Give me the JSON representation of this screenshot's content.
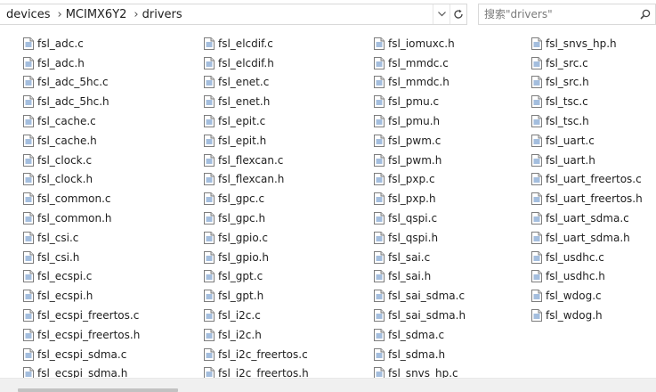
{
  "address_bar": {
    "crumbs": [
      "devices",
      "MCIMX6Y2",
      "drivers"
    ]
  },
  "search": {
    "placeholder": "搜索\"drivers\""
  },
  "files": {
    "columns": [
      [
        "fsl_adc.c",
        "fsl_adc.h",
        "fsl_adc_5hc.c",
        "fsl_adc_5hc.h",
        "fsl_cache.c",
        "fsl_cache.h",
        "fsl_clock.c",
        "fsl_clock.h",
        "fsl_common.c",
        "fsl_common.h",
        "fsl_csi.c",
        "fsl_csi.h",
        "fsl_ecspi.c",
        "fsl_ecspi.h",
        "fsl_ecspi_freertos.c",
        "fsl_ecspi_freertos.h",
        "fsl_ecspi_sdma.c",
        "fsl_ecspi_sdma.h"
      ],
      [
        "fsl_elcdif.c",
        "fsl_elcdif.h",
        "fsl_enet.c",
        "fsl_enet.h",
        "fsl_epit.c",
        "fsl_epit.h",
        "fsl_flexcan.c",
        "fsl_flexcan.h",
        "fsl_gpc.c",
        "fsl_gpc.h",
        "fsl_gpio.c",
        "fsl_gpio.h",
        "fsl_gpt.c",
        "fsl_gpt.h",
        "fsl_i2c.c",
        "fsl_i2c.h",
        "fsl_i2c_freertos.c",
        "fsl_i2c_freertos.h"
      ],
      [
        "fsl_iomuxc.h",
        "fsl_mmdc.c",
        "fsl_mmdc.h",
        "fsl_pmu.c",
        "fsl_pmu.h",
        "fsl_pwm.c",
        "fsl_pwm.h",
        "fsl_pxp.c",
        "fsl_pxp.h",
        "fsl_qspi.c",
        "fsl_qspi.h",
        "fsl_sai.c",
        "fsl_sai.h",
        "fsl_sai_sdma.c",
        "fsl_sai_sdma.h",
        "fsl_sdma.c",
        "fsl_sdma.h",
        "fsl_snvs_hp.c"
      ],
      [
        "fsl_snvs_hp.h",
        "fsl_src.c",
        "fsl_src.h",
        "fsl_tsc.c",
        "fsl_tsc.h",
        "fsl_uart.c",
        "fsl_uart.h",
        "fsl_uart_freertos.c",
        "fsl_uart_freertos.h",
        "fsl_uart_sdma.c",
        "fsl_uart_sdma.h",
        "fsl_usdhc.c",
        "fsl_usdhc.h",
        "fsl_wdog.c",
        "fsl_wdog.h"
      ]
    ]
  },
  "icons": {
    "file": "text-file-icon",
    "dropdown": "chevron-down-icon",
    "refresh": "refresh-icon",
    "search": "search-icon"
  }
}
